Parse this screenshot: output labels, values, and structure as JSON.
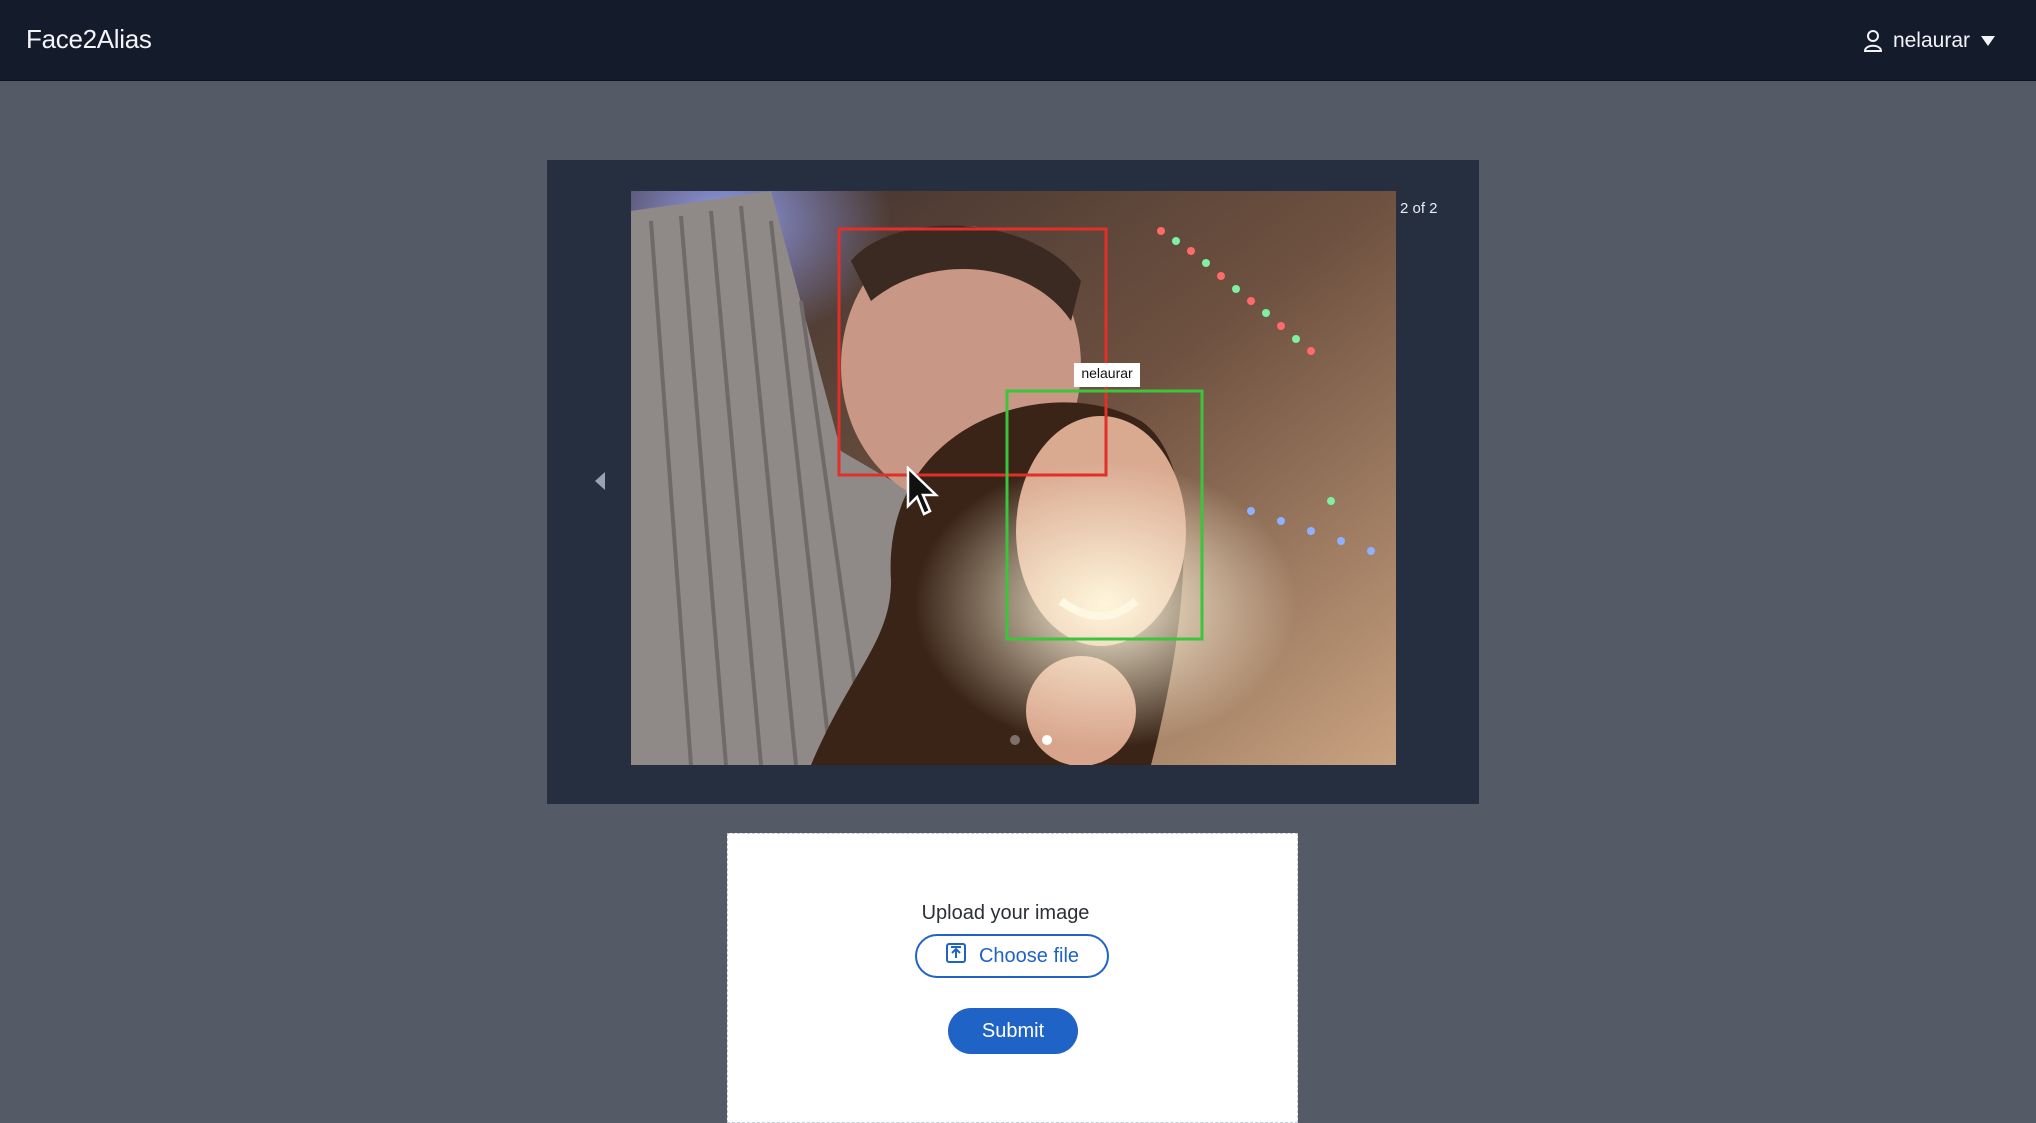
{
  "header": {
    "brand": "Face2Alias",
    "user": {
      "name": "nelaurar",
      "icon": "user-icon",
      "caret_icon": "caret-down-icon"
    }
  },
  "carousel": {
    "counter": "2 of 2",
    "prev_icon": "chevron-left-icon",
    "slide_count": 2,
    "active_slide": 2,
    "photo": {
      "description_icon": "photo-image",
      "faces": [
        {
          "label": "",
          "color": "#e0302a",
          "matched": false
        },
        {
          "label": "nelaurar",
          "color": "#3cc43c",
          "matched": true
        }
      ]
    }
  },
  "upload": {
    "label": "Upload your image",
    "choose_label": "Choose file",
    "choose_icon": "upload-file-icon",
    "submit_label": "Submit"
  },
  "colors": {
    "page_bg": "#545a66",
    "topbar_bg": "#141b2b",
    "carousel_bg": "#262f40",
    "primary": "#1f63c6"
  }
}
